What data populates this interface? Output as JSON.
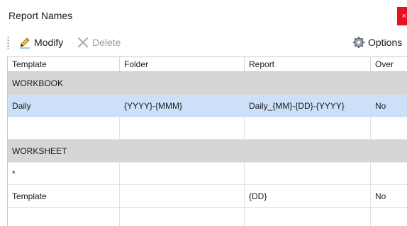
{
  "window": {
    "title": "Report Names",
    "close_glyph": "×"
  },
  "toolbar": {
    "modify_label": "Modify",
    "delete_label": "Delete",
    "options_label": "Options",
    "icons": {
      "modify": "pencil-icon",
      "delete": "x-delete-icon",
      "options": "gear-icon"
    }
  },
  "grid": {
    "columns": [
      "Template",
      "Folder",
      "Report",
      "Over"
    ],
    "groups": [
      {
        "name": "WORKBOOK",
        "rows": [
          {
            "template": "Daily",
            "folder": "{YYYY}-{MMM}",
            "report": "Daily_{MM}-{DD}-{YYYY}",
            "over": "No",
            "selected": true
          },
          {
            "template": "",
            "folder": "",
            "report": "",
            "over": ""
          }
        ]
      },
      {
        "name": "WORKSHEET",
        "rows": [
          {
            "template": "*",
            "folder": "",
            "report": "",
            "over": ""
          },
          {
            "template": "Template",
            "folder": "",
            "report": "{DD}",
            "over": "No"
          },
          {
            "template": "",
            "folder": "",
            "report": "",
            "over": ""
          }
        ]
      }
    ]
  },
  "colors": {
    "selected_row": "#cce0f7",
    "group_band": "#d6d6d6",
    "close_button": "#e81123"
  }
}
